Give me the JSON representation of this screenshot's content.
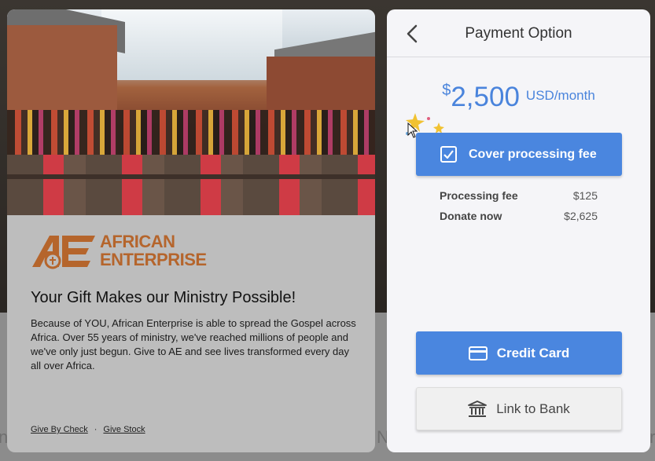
{
  "background": {
    "fragments": [
      "n",
      "N",
      "r"
    ]
  },
  "left_card": {
    "logo_line1": "AFRICAN",
    "logo_line2": "ENTERPRISE",
    "title": "Your Gift Makes our Ministry Possible!",
    "body": "Because of YOU, African Enterprise is able to spread the Gospel across Africa. Over 55 years of ministry, we've reached millions of people and we've only just begun. Give to AE and see lives transformed every day all over Africa.",
    "links": {
      "give_by_check": "Give By Check",
      "separator": "·",
      "give_stock": "Give Stock"
    },
    "brand_color": "#b5652c"
  },
  "panel": {
    "title": "Payment Option",
    "currency_symbol": "$",
    "amount": "2,500",
    "frequency": "USD/month",
    "cover_fee_label": "Cover processing fee",
    "cover_fee_checked": true,
    "processing_fee_label": "Processing fee",
    "processing_fee_value": "$125",
    "donate_now_label": "Donate now",
    "donate_now_value": "$2,625",
    "credit_card_label": "Credit Card",
    "bank_label": "Link to Bank",
    "accent_color": "#4a86df",
    "icons": [
      "chevron-left-icon",
      "checkbox-icon",
      "credit-card-icon",
      "bank-icon",
      "sparkle-icon",
      "cursor-icon"
    ]
  }
}
